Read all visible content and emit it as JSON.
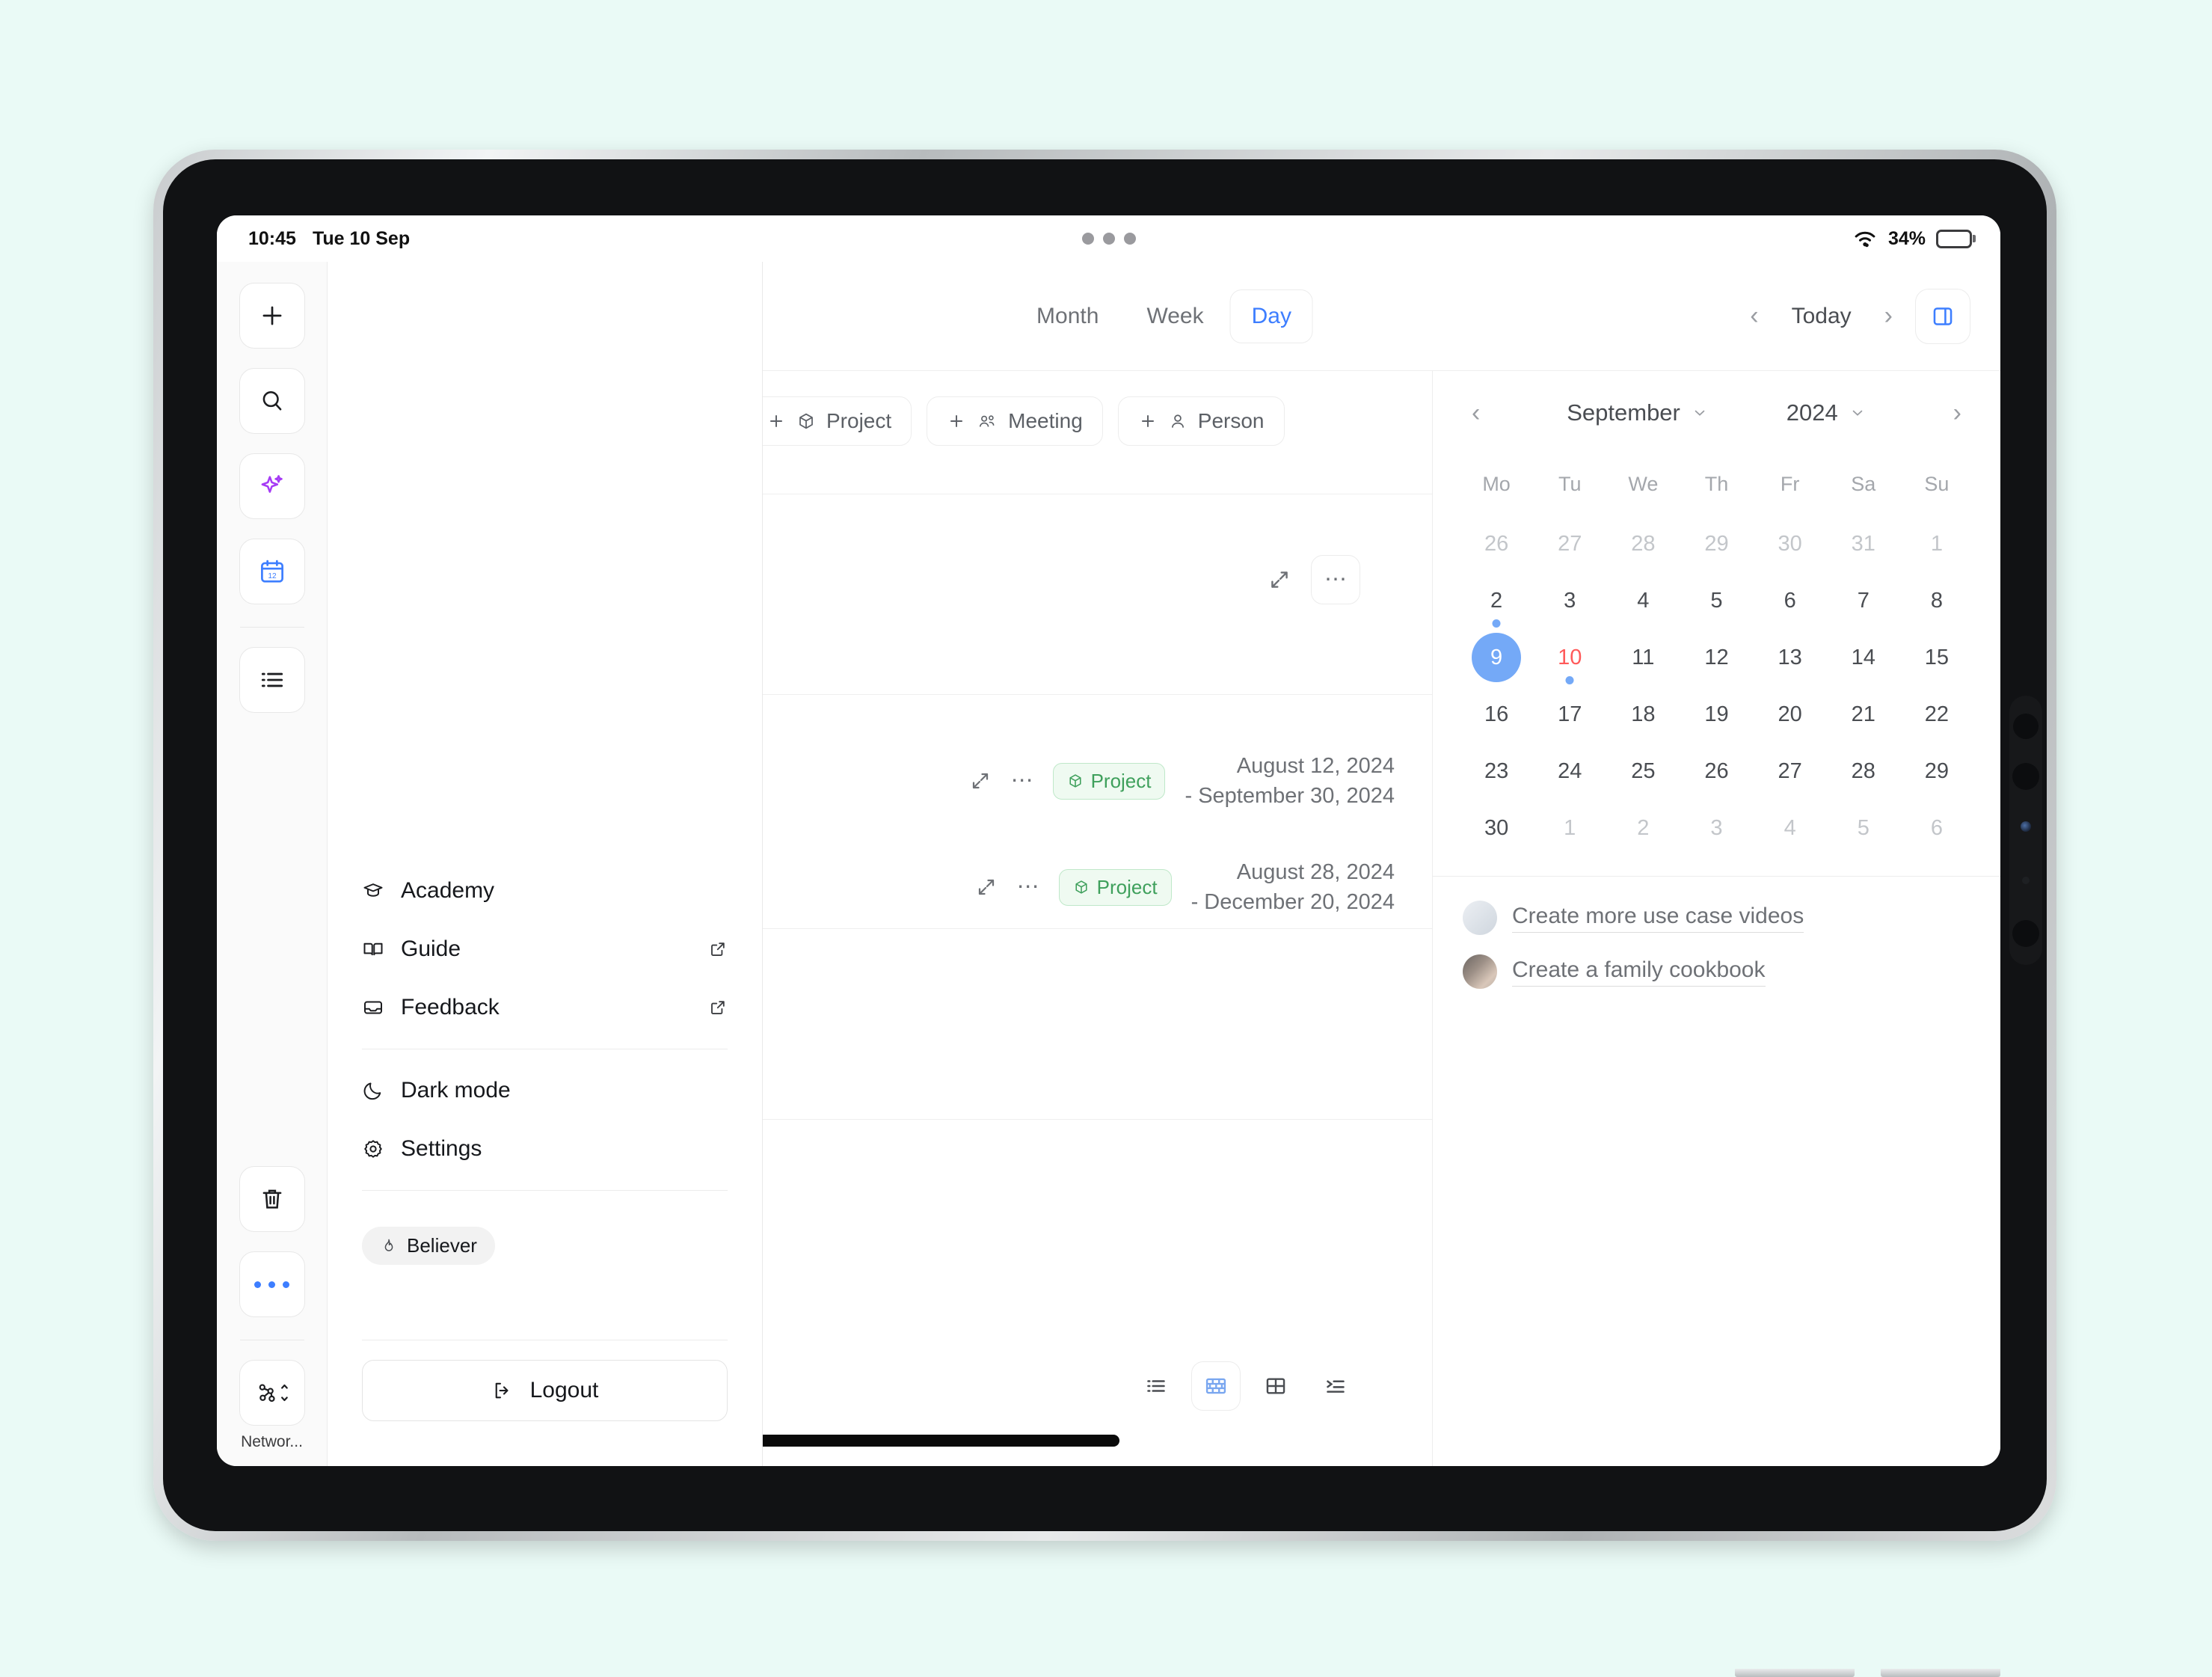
{
  "status_bar": {
    "time": "10:45",
    "date": "Tue 10 Sep",
    "battery_percent": "34%",
    "wifi_icon": "wifi-icon",
    "battery_icon": "battery-icon",
    "multitask_dots_icon": "multitask-handle-icon"
  },
  "left_rail": {
    "items": [
      {
        "name": "new-button",
        "icon": "plus-icon"
      },
      {
        "name": "search-button",
        "icon": "search-icon"
      },
      {
        "name": "ai-button",
        "icon": "sparkle-icon"
      },
      {
        "name": "calendar-button",
        "icon": "calendar-12-icon"
      },
      {
        "name": "list-button",
        "icon": "list-icon"
      },
      {
        "name": "trash-button",
        "icon": "trash-icon"
      },
      {
        "name": "more-button",
        "icon": "ellipsis-icon"
      },
      {
        "name": "network-switcher-button",
        "icon": "network-nodes-icon"
      }
    ],
    "network_label": "Networ...",
    "accent": "#3d7eff",
    "ai_accent": "#a63bf5"
  },
  "account_menu": {
    "items": [
      {
        "label": "Academy",
        "icon": "graduation-cap-icon",
        "external": false
      },
      {
        "label": "Guide",
        "icon": "book-open-icon",
        "external": true
      },
      {
        "label": "Feedback",
        "icon": "inbox-icon",
        "external": true
      },
      {
        "label": "Dark mode",
        "icon": "moon-icon",
        "external": false
      },
      {
        "label": "Settings",
        "icon": "gear-icon",
        "external": false
      }
    ],
    "plan_badge": {
      "label": "Believer",
      "icon": "flame-icon"
    },
    "logout_label": "Logout",
    "logout_icon": "logout-icon"
  },
  "toolbar": {
    "views": [
      {
        "label": "Month",
        "active": false
      },
      {
        "label": "Week",
        "active": false
      },
      {
        "label": "Day",
        "active": true
      }
    ],
    "prev_icon": "chevron-left-icon",
    "today_label": "Today",
    "next_icon": "chevron-right-icon",
    "panel_toggle_icon": "right-panel-icon",
    "active_color": "#3d7eff"
  },
  "content": {
    "chips": [
      {
        "label": "Project",
        "icon": "box-icon",
        "has_plus": false
      },
      {
        "label": "Meeting",
        "icon": "people-icon",
        "has_plus": true
      },
      {
        "label": "Person",
        "icon": "person-icon",
        "has_plus": true
      }
    ],
    "rows": [
      {
        "expand_icon": "expand-icon",
        "kebab_icon": "ellipsis-icon",
        "badge": "Project",
        "badge_icon": "box-icon",
        "date_start": "August 12, 2024",
        "date_end": "- September 30, 2024"
      },
      {
        "expand_icon": "expand-icon",
        "kebab_icon": "ellipsis-icon",
        "badge": "Project",
        "badge_icon": "box-icon",
        "date_start": "August 28, 2024",
        "date_end": "- December 20, 2024"
      }
    ],
    "view_modes": [
      {
        "name": "list-view",
        "icon": "bullet-list-icon",
        "active": false
      },
      {
        "name": "board-view",
        "icon": "brick-wall-icon",
        "active": true
      },
      {
        "name": "grid-view",
        "icon": "grid-icon",
        "active": false
      },
      {
        "name": "outline-view",
        "icon": "outline-icon",
        "active": false
      }
    ],
    "view_mode_active_color": "#7aa7f0"
  },
  "calendar": {
    "prev_icon": "chevron-left-icon",
    "next_icon": "chevron-right-icon",
    "month": "September",
    "year": "2024",
    "month_caret": "chevron-down-icon",
    "year_caret": "chevron-down-icon",
    "dow": [
      "Mo",
      "Tu",
      "We",
      "Th",
      "Fr",
      "Sa",
      "Su"
    ],
    "weeks": [
      [
        {
          "d": "26",
          "muted": true
        },
        {
          "d": "27",
          "muted": true
        },
        {
          "d": "28",
          "muted": true
        },
        {
          "d": "29",
          "muted": true
        },
        {
          "d": "30",
          "muted": true
        },
        {
          "d": "31",
          "muted": true
        },
        {
          "d": "1",
          "muted": true
        }
      ],
      [
        {
          "d": "2",
          "dot": true
        },
        {
          "d": "3"
        },
        {
          "d": "4"
        },
        {
          "d": "5"
        },
        {
          "d": "6"
        },
        {
          "d": "7"
        },
        {
          "d": "8"
        }
      ],
      [
        {
          "d": "9",
          "selected": true
        },
        {
          "d": "10",
          "today": true,
          "dot": true
        },
        {
          "d": "11"
        },
        {
          "d": "12"
        },
        {
          "d": "13"
        },
        {
          "d": "14"
        },
        {
          "d": "15"
        }
      ],
      [
        {
          "d": "16"
        },
        {
          "d": "17"
        },
        {
          "d": "18"
        },
        {
          "d": "19"
        },
        {
          "d": "20"
        },
        {
          "d": "21"
        },
        {
          "d": "22"
        }
      ],
      [
        {
          "d": "23"
        },
        {
          "d": "24"
        },
        {
          "d": "25"
        },
        {
          "d": "26"
        },
        {
          "d": "27"
        },
        {
          "d": "28"
        },
        {
          "d": "29"
        }
      ],
      [
        {
          "d": "30"
        },
        {
          "d": "1",
          "muted": true
        },
        {
          "d": "2",
          "muted": true
        },
        {
          "d": "3",
          "muted": true
        },
        {
          "d": "4",
          "muted": true
        },
        {
          "d": "5",
          "muted": true
        },
        {
          "d": "6",
          "muted": true
        }
      ]
    ],
    "selected_color": "#74a9f7",
    "today_color": "#ff5a5a"
  },
  "suggestions": [
    {
      "label": "Create more use case videos",
      "thumb": "whiteboard-photo"
    },
    {
      "label": "Create a family cookbook",
      "thumb": "cooking-photo"
    }
  ]
}
